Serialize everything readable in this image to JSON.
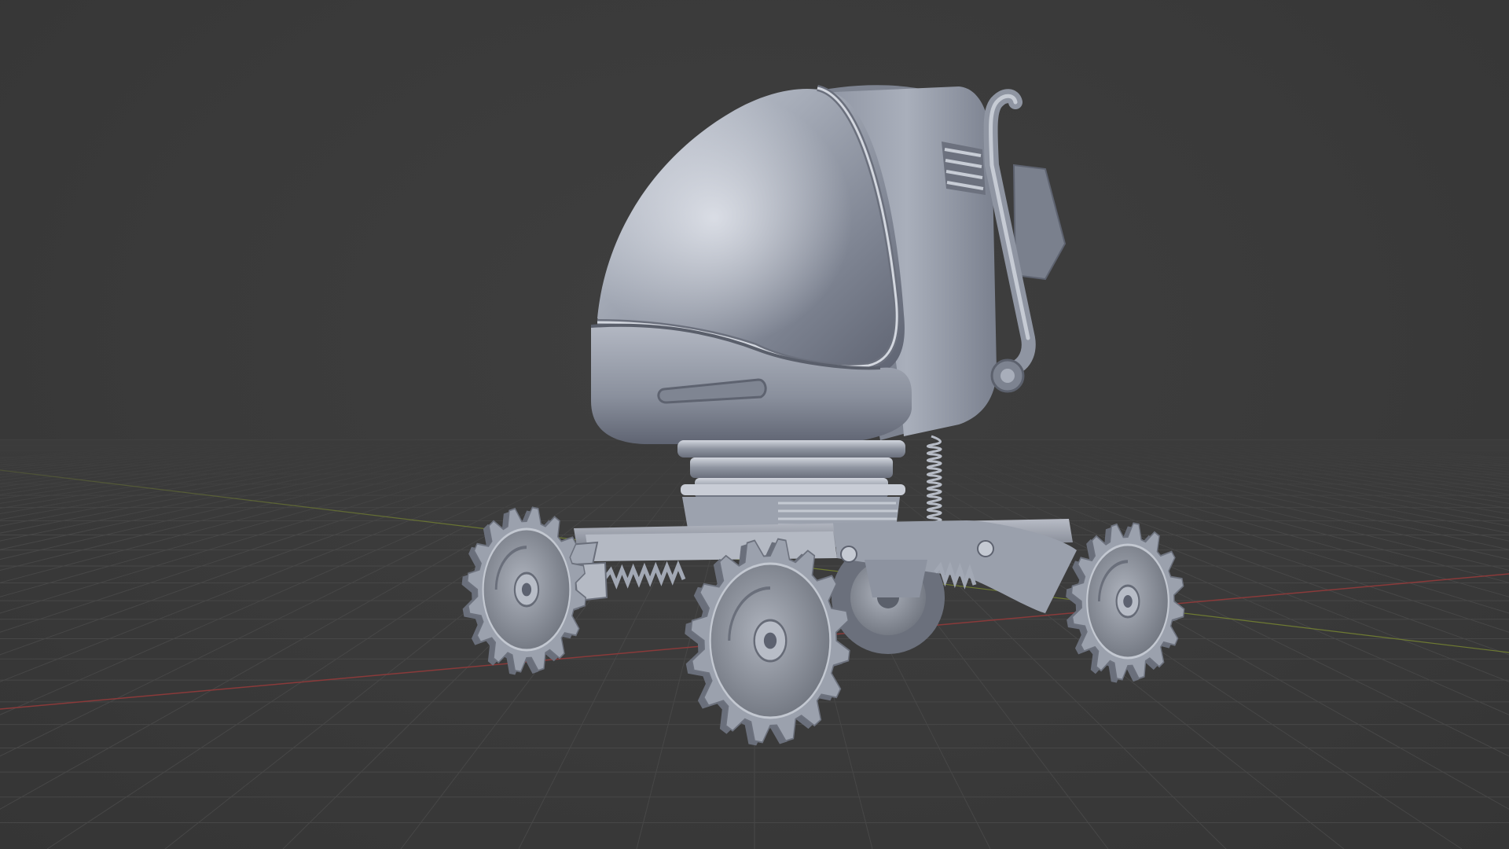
{
  "app": {
    "view": "3d-viewport"
  },
  "viewport": {
    "background_color": "#3b3b3b",
    "grid_color": "#474747",
    "x_axis_color": "#8a3a3a",
    "y_axis_color": "#6e7a32"
  },
  "scene": {
    "model_material_color": "#9aa0ad",
    "model_shadow_color": "#5d6270",
    "model_highlight_color": "#d6dae3",
    "wheel_count": 4
  }
}
